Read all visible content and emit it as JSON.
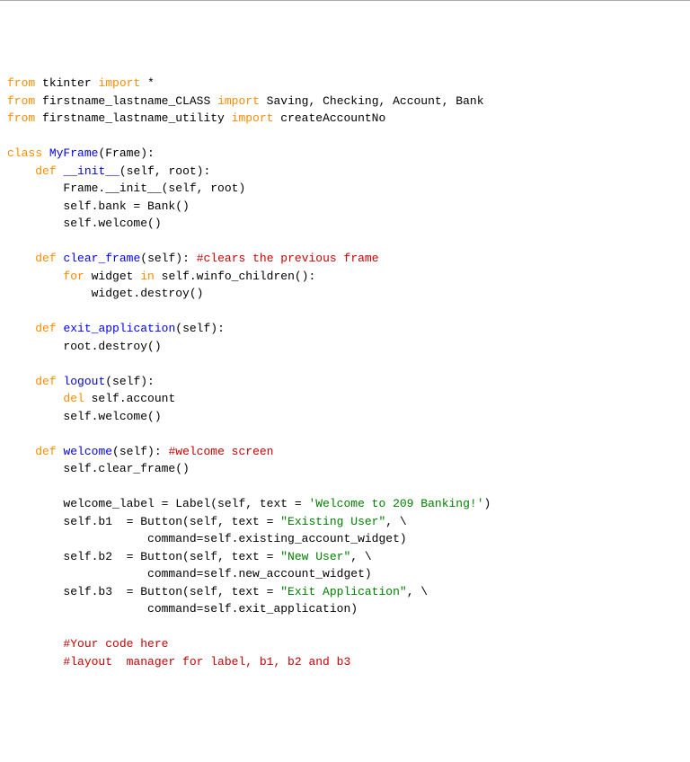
{
  "code": {
    "line1a": "from",
    "line1b": " tkinter ",
    "line1c": "import",
    "line1d": " *",
    "line2a": "from",
    "line2b": " firstname_lastname_CLASS ",
    "line2c": "import",
    "line2d": " Saving, Checking, Account, Bank",
    "line3a": "from",
    "line3b": " firstname_lastname_utility ",
    "line3c": "import",
    "line3d": " createAccountNo",
    "line5a": "class",
    "line5b": " ",
    "line5c": "MyFrame",
    "line5d": "(Frame):",
    "line6a": "    ",
    "line6b": "def",
    "line6c": " ",
    "line6d": "__init__",
    "line6e": "(self, root):",
    "line7": "        Frame.__init__(self, root)",
    "line8": "        self.bank = Bank()",
    "line9": "        self.welcome()",
    "line11a": "    ",
    "line11b": "def",
    "line11c": " ",
    "line11d": "clear_frame",
    "line11e": "(self): ",
    "line11f": "#clears the previous frame",
    "line12a": "        ",
    "line12b": "for",
    "line12c": " widget ",
    "line12d": "in",
    "line12e": " self.winfo_children():",
    "line13": "            widget.destroy()",
    "line15a": "    ",
    "line15b": "def",
    "line15c": " ",
    "line15d": "exit_application",
    "line15e": "(self):",
    "line16": "        root.destroy()",
    "line18a": "    ",
    "line18b": "def",
    "line18c": " ",
    "line18d": "logout",
    "line18e": "(self):",
    "line19a": "        ",
    "line19b": "del",
    "line19c": " self.account",
    "line20": "        self.welcome()",
    "line22a": "    ",
    "line22b": "def",
    "line22c": " ",
    "line22d": "welcome",
    "line22e": "(self): ",
    "line22f": "#welcome screen",
    "line23": "        self.clear_frame()",
    "line25a": "        welcome_label = Label(self, text = ",
    "line25b": "'Welcome to 209 Banking!'",
    "line25c": ")",
    "line26a": "        self.b1  = Button(self, text = ",
    "line26b": "\"Existing User\"",
    "line26c": ", \\",
    "line27": "                    command=self.existing_account_widget)",
    "line28a": "        self.b2  = Button(self, text = ",
    "line28b": "\"New User\"",
    "line28c": ", \\",
    "line29": "                    command=self.new_account_widget)",
    "line30a": "        self.b3  = Button(self, text = ",
    "line30b": "\"Exit Application\"",
    "line30c": ", \\",
    "line31": "                    command=self.exit_application)",
    "line33": "        #Your code here",
    "line34": "        #layout  manager for label, b1, b2 and b3"
  }
}
